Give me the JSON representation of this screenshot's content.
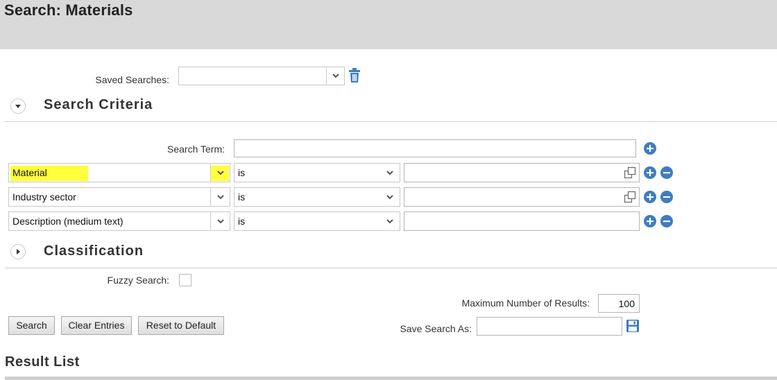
{
  "page": {
    "title": "Search: Materials"
  },
  "saved_searches": {
    "label": "Saved Searches:",
    "value": ""
  },
  "sections": {
    "search_criteria": "Search Criteria",
    "classification": "Classification",
    "result_list": "Result List"
  },
  "search_term": {
    "label": "Search Term:",
    "value": ""
  },
  "criteria_rows": [
    {
      "field": "Material",
      "operator": "is",
      "value": ""
    },
    {
      "field": "Industry sector",
      "operator": "is",
      "value": ""
    },
    {
      "field": "Description (medium text)",
      "operator": "is",
      "value": ""
    }
  ],
  "fuzzy_search": {
    "label": "Fuzzy Search:",
    "checked": false
  },
  "max_results": {
    "label": "Maximum Number of Results:",
    "value": "100"
  },
  "save_search_as": {
    "label": "Save Search As:",
    "value": ""
  },
  "buttons": {
    "search": "Search",
    "clear": "Clear Entries",
    "reset": "Reset to Default"
  },
  "colors": {
    "header_bg": "#d9d9d9",
    "icon_blue": "#3e7dbf",
    "highlight": "#ffff3d"
  },
  "icons": [
    "delete-icon",
    "expand-icon",
    "collapse-icon",
    "chevron-down-icon",
    "add-icon",
    "remove-icon",
    "value-help-icon",
    "save-icon"
  ]
}
